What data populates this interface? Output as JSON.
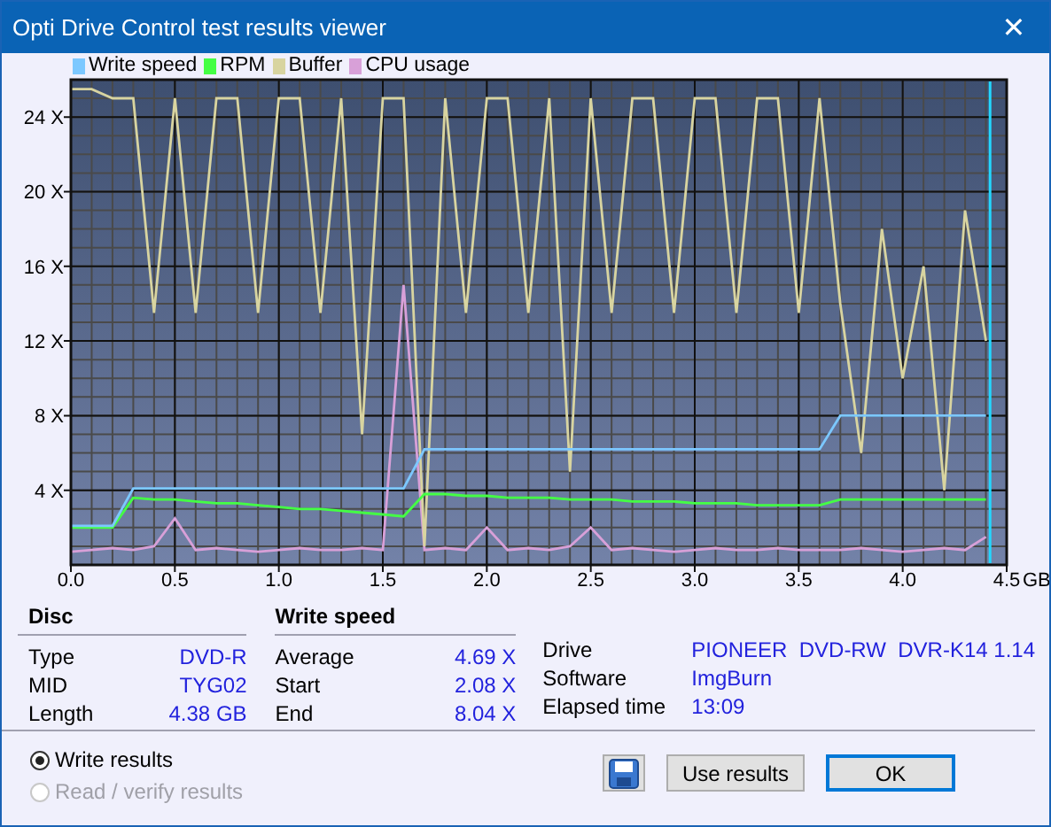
{
  "window": {
    "title": "Opti Drive Control test results viewer",
    "close": "✕"
  },
  "chart": {
    "chart_data": {
      "type": "line",
      "x": [
        0.0,
        0.1,
        0.2,
        0.3,
        0.4,
        0.5,
        0.6,
        0.7,
        0.8,
        0.9,
        1.0,
        1.1,
        1.2,
        1.3,
        1.4,
        1.5,
        1.6,
        1.7,
        1.8,
        1.9,
        2.0,
        2.1,
        2.2,
        2.3,
        2.4,
        2.5,
        2.6,
        2.7,
        2.8,
        2.9,
        3.0,
        3.1,
        3.2,
        3.3,
        3.4,
        3.5,
        3.6,
        3.7,
        3.8,
        3.9,
        4.0,
        4.1,
        4.2,
        4.3,
        4.4
      ],
      "series": [
        {
          "name": "Write speed",
          "color": "#7cc8ff",
          "values": [
            2.1,
            2.1,
            2.1,
            4.1,
            4.1,
            4.1,
            4.1,
            4.1,
            4.1,
            4.1,
            4.1,
            4.1,
            4.1,
            4.1,
            4.1,
            4.1,
            4.1,
            6.2,
            6.2,
            6.2,
            6.2,
            6.2,
            6.2,
            6.2,
            6.2,
            6.2,
            6.2,
            6.2,
            6.2,
            6.2,
            6.2,
            6.2,
            6.2,
            6.2,
            6.2,
            6.2,
            6.2,
            8.0,
            8.0,
            8.0,
            8.0,
            8.0,
            8.0,
            8.0,
            8.0
          ]
        },
        {
          "name": "RPM",
          "color": "#44ff44",
          "values": [
            2.0,
            2.0,
            2.0,
            3.6,
            3.5,
            3.5,
            3.4,
            3.3,
            3.3,
            3.2,
            3.1,
            3.0,
            3.0,
            2.9,
            2.8,
            2.7,
            2.6,
            3.8,
            3.8,
            3.7,
            3.7,
            3.6,
            3.6,
            3.6,
            3.5,
            3.5,
            3.5,
            3.4,
            3.4,
            3.4,
            3.3,
            3.3,
            3.3,
            3.2,
            3.2,
            3.2,
            3.2,
            3.5,
            3.5,
            3.5,
            3.5,
            3.5,
            3.5,
            3.5,
            3.5
          ]
        },
        {
          "name": "Buffer",
          "color": "#d8d4a0",
          "values": [
            25.5,
            25.5,
            25,
            25,
            13.5,
            25,
            13.5,
            25,
            25,
            13.5,
            25,
            25,
            13.5,
            25,
            7,
            25,
            25,
            1,
            25,
            13.5,
            25,
            25,
            13.5,
            25,
            5,
            25,
            13.5,
            25,
            25,
            13.5,
            25,
            25,
            13.5,
            25,
            25,
            13.5,
            25,
            14,
            6,
            18,
            10,
            16,
            4,
            19,
            12
          ]
        },
        {
          "name": "CPU usage",
          "color": "#d8a0d8",
          "values": [
            0.7,
            0.8,
            0.9,
            0.8,
            1.0,
            2.5,
            0.8,
            0.9,
            0.8,
            0.7,
            0.8,
            0.9,
            0.8,
            0.8,
            0.9,
            0.8,
            15,
            0.8,
            0.9,
            0.8,
            2.0,
            0.8,
            0.9,
            0.8,
            1.0,
            2.0,
            0.8,
            0.9,
            0.8,
            0.7,
            0.8,
            0.9,
            0.8,
            0.8,
            0.9,
            0.8,
            0.8,
            0.8,
            0.9,
            0.8,
            0.7,
            0.8,
            0.9,
            0.8,
            1.5
          ]
        }
      ],
      "xlim": [
        0,
        4.5
      ],
      "ylim": [
        0,
        26
      ],
      "xticks": [
        {
          "value": 0,
          "label": "0.0"
        },
        {
          "value": 0.5,
          "label": "0.5"
        },
        {
          "value": 1,
          "label": "1.0"
        },
        {
          "value": 1.5,
          "label": "1.5"
        },
        {
          "value": 2,
          "label": "2.0"
        },
        {
          "value": 2.5,
          "label": "2.5"
        },
        {
          "value": 3,
          "label": "3.0"
        },
        {
          "value": 3.5,
          "label": "3.5"
        },
        {
          "value": 4,
          "label": "4.0"
        },
        {
          "value": 4.5,
          "label": "4.5"
        }
      ],
      "xlabel": "GB",
      "grid": true,
      "ref_lines": [
        {
          "axis": "x",
          "value": 4.42,
          "color": "#22d8ff"
        }
      ],
      "yticks": [
        {
          "value": 4,
          "label": "4 X"
        },
        {
          "value": 8,
          "label": "8 X"
        },
        {
          "value": 12,
          "label": "12 X"
        },
        {
          "value": 16,
          "label": "16 X"
        },
        {
          "value": 20,
          "label": "20 X"
        },
        {
          "value": 24,
          "label": "24 X"
        }
      ]
    }
  },
  "disc": {
    "heading": "Disc",
    "rows": [
      {
        "label": "Type",
        "value": "DVD-R"
      },
      {
        "label": "MID",
        "value": "TYG02"
      },
      {
        "label": "Length",
        "value": "4.38 GB"
      }
    ]
  },
  "write_speed": {
    "heading": "Write speed",
    "rows": [
      {
        "label": "Average",
        "value": "4.69 X"
      },
      {
        "label": "Start",
        "value": "2.08 X"
      },
      {
        "label": "End",
        "value": "8.04 X"
      }
    ]
  },
  "info": [
    {
      "label": "Drive",
      "value": "PIONEER  DVD-RW  DVR-K14 1.14"
    },
    {
      "label": "Software",
      "value": "ImgBurn"
    },
    {
      "label": "Elapsed time",
      "value": "13:09"
    }
  ],
  "results": [
    {
      "label": "Write results",
      "selected": true,
      "disabled": false
    },
    {
      "label": "Read / verify results",
      "selected": false,
      "disabled": true
    }
  ],
  "buttons": [
    {
      "kind": "save"
    },
    {
      "kind": "text",
      "label": "Use results",
      "default": false
    },
    {
      "kind": "text",
      "label": "OK",
      "default": true
    }
  ]
}
